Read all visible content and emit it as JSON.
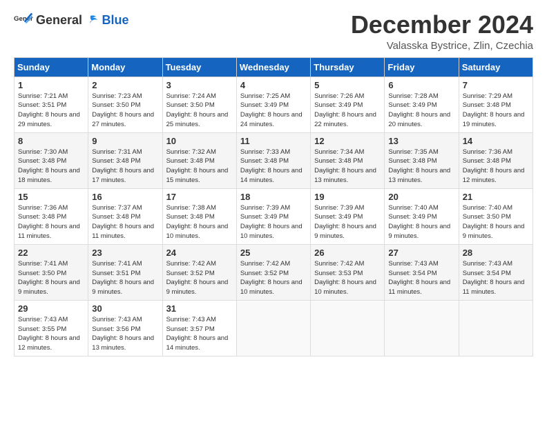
{
  "header": {
    "logo_general": "General",
    "logo_blue": "Blue",
    "title": "December 2024",
    "location": "Valasska Bystrice, Zlin, Czechia"
  },
  "weekdays": [
    "Sunday",
    "Monday",
    "Tuesday",
    "Wednesday",
    "Thursday",
    "Friday",
    "Saturday"
  ],
  "weeks": [
    [
      {
        "day": "1",
        "sunrise": "Sunrise: 7:21 AM",
        "sunset": "Sunset: 3:51 PM",
        "daylight": "Daylight: 8 hours and 29 minutes."
      },
      {
        "day": "2",
        "sunrise": "Sunrise: 7:23 AM",
        "sunset": "Sunset: 3:50 PM",
        "daylight": "Daylight: 8 hours and 27 minutes."
      },
      {
        "day": "3",
        "sunrise": "Sunrise: 7:24 AM",
        "sunset": "Sunset: 3:50 PM",
        "daylight": "Daylight: 8 hours and 25 minutes."
      },
      {
        "day": "4",
        "sunrise": "Sunrise: 7:25 AM",
        "sunset": "Sunset: 3:49 PM",
        "daylight": "Daylight: 8 hours and 24 minutes."
      },
      {
        "day": "5",
        "sunrise": "Sunrise: 7:26 AM",
        "sunset": "Sunset: 3:49 PM",
        "daylight": "Daylight: 8 hours and 22 minutes."
      },
      {
        "day": "6",
        "sunrise": "Sunrise: 7:28 AM",
        "sunset": "Sunset: 3:49 PM",
        "daylight": "Daylight: 8 hours and 20 minutes."
      },
      {
        "day": "7",
        "sunrise": "Sunrise: 7:29 AM",
        "sunset": "Sunset: 3:48 PM",
        "daylight": "Daylight: 8 hours and 19 minutes."
      }
    ],
    [
      {
        "day": "8",
        "sunrise": "Sunrise: 7:30 AM",
        "sunset": "Sunset: 3:48 PM",
        "daylight": "Daylight: 8 hours and 18 minutes."
      },
      {
        "day": "9",
        "sunrise": "Sunrise: 7:31 AM",
        "sunset": "Sunset: 3:48 PM",
        "daylight": "Daylight: 8 hours and 17 minutes."
      },
      {
        "day": "10",
        "sunrise": "Sunrise: 7:32 AM",
        "sunset": "Sunset: 3:48 PM",
        "daylight": "Daylight: 8 hours and 15 minutes."
      },
      {
        "day": "11",
        "sunrise": "Sunrise: 7:33 AM",
        "sunset": "Sunset: 3:48 PM",
        "daylight": "Daylight: 8 hours and 14 minutes."
      },
      {
        "day": "12",
        "sunrise": "Sunrise: 7:34 AM",
        "sunset": "Sunset: 3:48 PM",
        "daylight": "Daylight: 8 hours and 13 minutes."
      },
      {
        "day": "13",
        "sunrise": "Sunrise: 7:35 AM",
        "sunset": "Sunset: 3:48 PM",
        "daylight": "Daylight: 8 hours and 13 minutes."
      },
      {
        "day": "14",
        "sunrise": "Sunrise: 7:36 AM",
        "sunset": "Sunset: 3:48 PM",
        "daylight": "Daylight: 8 hours and 12 minutes."
      }
    ],
    [
      {
        "day": "15",
        "sunrise": "Sunrise: 7:36 AM",
        "sunset": "Sunset: 3:48 PM",
        "daylight": "Daylight: 8 hours and 11 minutes."
      },
      {
        "day": "16",
        "sunrise": "Sunrise: 7:37 AM",
        "sunset": "Sunset: 3:48 PM",
        "daylight": "Daylight: 8 hours and 11 minutes."
      },
      {
        "day": "17",
        "sunrise": "Sunrise: 7:38 AM",
        "sunset": "Sunset: 3:48 PM",
        "daylight": "Daylight: 8 hours and 10 minutes."
      },
      {
        "day": "18",
        "sunrise": "Sunrise: 7:39 AM",
        "sunset": "Sunset: 3:49 PM",
        "daylight": "Daylight: 8 hours and 10 minutes."
      },
      {
        "day": "19",
        "sunrise": "Sunrise: 7:39 AM",
        "sunset": "Sunset: 3:49 PM",
        "daylight": "Daylight: 8 hours and 9 minutes."
      },
      {
        "day": "20",
        "sunrise": "Sunrise: 7:40 AM",
        "sunset": "Sunset: 3:49 PM",
        "daylight": "Daylight: 8 hours and 9 minutes."
      },
      {
        "day": "21",
        "sunrise": "Sunrise: 7:40 AM",
        "sunset": "Sunset: 3:50 PM",
        "daylight": "Daylight: 8 hours and 9 minutes."
      }
    ],
    [
      {
        "day": "22",
        "sunrise": "Sunrise: 7:41 AM",
        "sunset": "Sunset: 3:50 PM",
        "daylight": "Daylight: 8 hours and 9 minutes."
      },
      {
        "day": "23",
        "sunrise": "Sunrise: 7:41 AM",
        "sunset": "Sunset: 3:51 PM",
        "daylight": "Daylight: 8 hours and 9 minutes."
      },
      {
        "day": "24",
        "sunrise": "Sunrise: 7:42 AM",
        "sunset": "Sunset: 3:52 PM",
        "daylight": "Daylight: 8 hours and 9 minutes."
      },
      {
        "day": "25",
        "sunrise": "Sunrise: 7:42 AM",
        "sunset": "Sunset: 3:52 PM",
        "daylight": "Daylight: 8 hours and 10 minutes."
      },
      {
        "day": "26",
        "sunrise": "Sunrise: 7:42 AM",
        "sunset": "Sunset: 3:53 PM",
        "daylight": "Daylight: 8 hours and 10 minutes."
      },
      {
        "day": "27",
        "sunrise": "Sunrise: 7:43 AM",
        "sunset": "Sunset: 3:54 PM",
        "daylight": "Daylight: 8 hours and 11 minutes."
      },
      {
        "day": "28",
        "sunrise": "Sunrise: 7:43 AM",
        "sunset": "Sunset: 3:54 PM",
        "daylight": "Daylight: 8 hours and 11 minutes."
      }
    ],
    [
      {
        "day": "29",
        "sunrise": "Sunrise: 7:43 AM",
        "sunset": "Sunset: 3:55 PM",
        "daylight": "Daylight: 8 hours and 12 minutes."
      },
      {
        "day": "30",
        "sunrise": "Sunrise: 7:43 AM",
        "sunset": "Sunset: 3:56 PM",
        "daylight": "Daylight: 8 hours and 13 minutes."
      },
      {
        "day": "31",
        "sunrise": "Sunrise: 7:43 AM",
        "sunset": "Sunset: 3:57 PM",
        "daylight": "Daylight: 8 hours and 14 minutes."
      },
      null,
      null,
      null,
      null
    ]
  ]
}
